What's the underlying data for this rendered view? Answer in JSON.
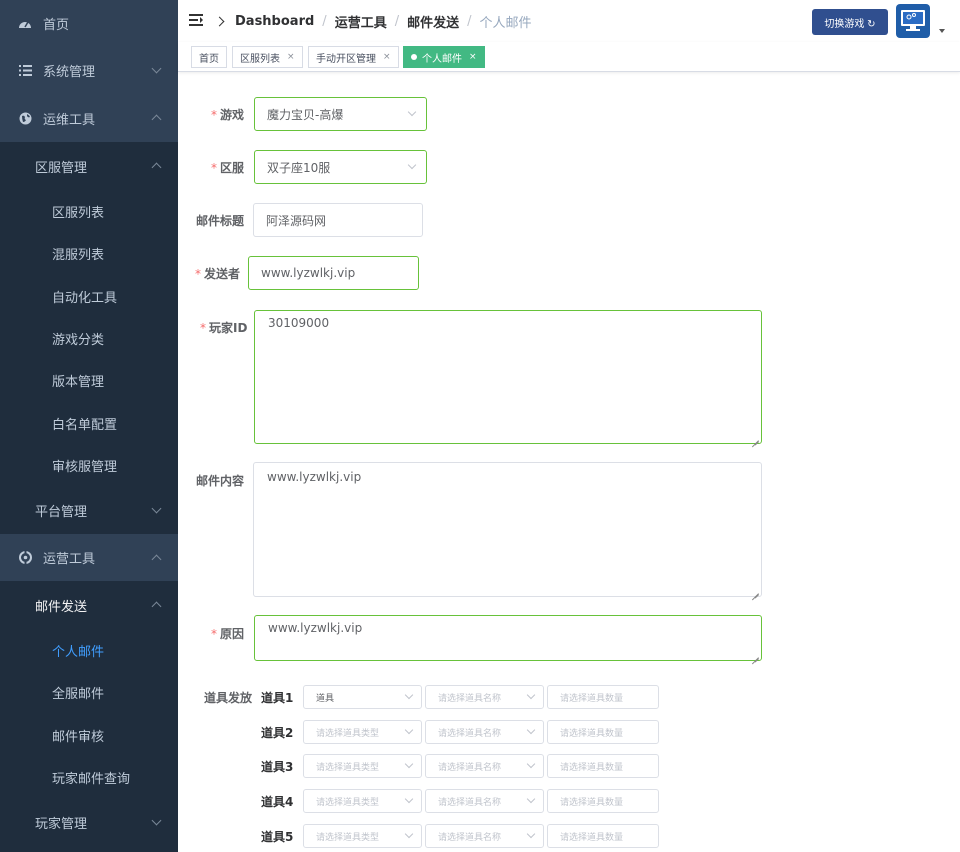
{
  "sidebar": {
    "home": "首页",
    "system": "系统管理",
    "ops": "运维工具",
    "zone_mgmt": "区服管理",
    "zone_list": "区服列表",
    "mixed_list": "混服列表",
    "automation": "自动化工具",
    "game_category": "游戏分类",
    "version": "版本管理",
    "whitelist": "白名单配置",
    "review_server": "审核服管理",
    "platform": "平台管理",
    "operations": "运营工具",
    "mail_send": "邮件发送",
    "personal_mail": "个人邮件",
    "all_server_mail": "全服邮件",
    "mail_review": "邮件审核",
    "player_mail_query": "玩家邮件查询",
    "player_mgmt": "玩家管理"
  },
  "breadcrumb": {
    "b1": "Dashboard",
    "b2": "运营工具",
    "b3": "邮件发送",
    "b4": "个人邮件",
    "sep": "/"
  },
  "header": {
    "switch_game": "切换游戏 ↻"
  },
  "tags": [
    {
      "label": "首页"
    },
    {
      "label": "区服列表",
      "close": "×"
    },
    {
      "label": "手动开区管理",
      "close": "×"
    },
    {
      "label": "个人邮件",
      "close": "×"
    }
  ],
  "form": {
    "req": "*",
    "game_label": "游戏",
    "game_value": "魔力宝贝-高爆",
    "zone_label": "区服",
    "zone_value": "双子座10服",
    "title_label": "邮件标题",
    "title_value": "阿泽源码网",
    "sender_label": "发送者",
    "sender_value": "www.lyzwlkj.vip",
    "player_label": "玩家ID",
    "player_value": "30109000",
    "content_label": "邮件内容",
    "content_value": "www.lyzwlkj.vip",
    "reason_label": "原因",
    "reason_value": "www.lyzwlkj.vip",
    "items_label": "道具发放",
    "items": [
      {
        "label": "道具1",
        "type": "道具",
        "name_ph": "请选择道具名称",
        "qty_ph": "请选择道具数量"
      },
      {
        "label": "道具2",
        "type": "请选择道具类型",
        "name_ph": "请选择道具名称",
        "qty_ph": "请选择道具数量"
      },
      {
        "label": "道具3",
        "type": "请选择道具类型",
        "name_ph": "请选择道具名称",
        "qty_ph": "请选择道具数量"
      },
      {
        "label": "道具4",
        "type": "请选择道具类型",
        "name_ph": "请选择道具名称",
        "qty_ph": "请选择道具数量"
      },
      {
        "label": "道具5",
        "type": "请选择道具类型",
        "name_ph": "请选择道具名称",
        "qty_ph": "请选择道具数量"
      }
    ]
  },
  "colors": {
    "sidebar_bg": "#304156",
    "submenu_bg": "#1f2d3d",
    "active_text": "#409eff",
    "tag_active": "#42b983",
    "valid_border": "#67c23a",
    "required": "#f56c6c",
    "switch_button": "#304f8f"
  }
}
